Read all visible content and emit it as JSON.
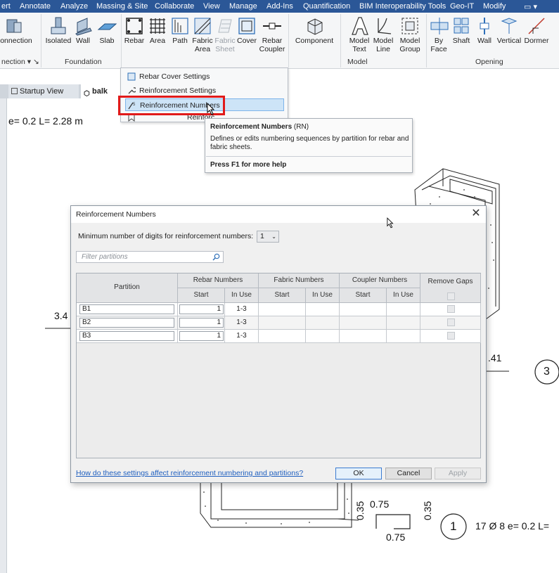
{
  "menubar": {
    "items": [
      "ert",
      "Annotate",
      "Analyze",
      "Massing & Site",
      "Collaborate",
      "View",
      "Manage",
      "Add-Ins",
      "Quantification",
      "BIM Interoperability Tools",
      "Geo-IT",
      "Modify"
    ],
    "extra": "▭ ▾"
  },
  "ribbon": {
    "tools": {
      "connection": "onnection",
      "isolated": "Isolated",
      "wall": "Wall",
      "slab": "Slab",
      "rebar": "Rebar",
      "area": "Area",
      "path": "Path",
      "fabric_area": "Fabric\nArea",
      "fabric_sheet": "Fabric\nSheet",
      "cover": "Cover",
      "rebar_coupler": "Rebar\nCoupler",
      "component": "Component",
      "model_text": "Model\nText",
      "model_line": "Model\nLine",
      "model_group": "Model\nGroup",
      "by_face": "By\nFace",
      "shaft": "Shaft",
      "wall_opening": "Wall",
      "vertical": "Vertical",
      "dormer": "Dormer"
    },
    "panels": {
      "connection": "nection ▾ ↘",
      "foundation": "Foundation",
      "model": "Model",
      "opening": "Opening"
    }
  },
  "view_tabs": {
    "startup": "Startup View",
    "balk": "balk"
  },
  "dropdown": {
    "items": [
      "Rebar Cover Settings",
      "Reinforcement Settings",
      "Reinforcement Numbers",
      "Reinforc"
    ]
  },
  "tooltip": {
    "title": "Reinforcement Numbers",
    "shortcut": "(RN)",
    "description": "Defines or edits numbering sequences by partition for rebar and fabric sheets.",
    "help": "Press F1 for more help"
  },
  "dialog": {
    "title": "Reinforcement Numbers",
    "min_digits_label": "Minimum number of digits for reinforcement numbers:",
    "min_digits_value": "1",
    "filter_placeholder": "Filter partitions",
    "headers": {
      "partition": "Partition",
      "rebar_numbers": "Rebar Numbers",
      "fabric_numbers": "Fabric Numbers",
      "coupler_numbers": "Coupler Numbers",
      "remove_gaps": "Remove Gaps",
      "start": "Start",
      "in_use": "In Use"
    },
    "rows": [
      {
        "partition": "B1",
        "rebar_start": "1",
        "rebar_in_use": "1-3"
      },
      {
        "partition": "B2",
        "rebar_start": "1",
        "rebar_in_use": "1-3"
      },
      {
        "partition": "B3",
        "rebar_start": "1",
        "rebar_in_use": "1-3"
      }
    ],
    "help_link": "How do these settings affect reinforcement numbering and partitions?",
    "ok": "OK",
    "cancel": "Cancel",
    "apply": "Apply"
  },
  "drawing": {
    "top_label": "e= 0.2 L= 2.28 m",
    "left_dim": "3.4",
    "right_dim": ".41",
    "tag_3": "3",
    "tag_1": "1",
    "bottom_label": "17 Ø 8 e= 0.2 L=",
    "dim_top": "0.75",
    "dim_bottom": "0.75",
    "dim_left": "0.35",
    "dim_right": "0.35"
  }
}
